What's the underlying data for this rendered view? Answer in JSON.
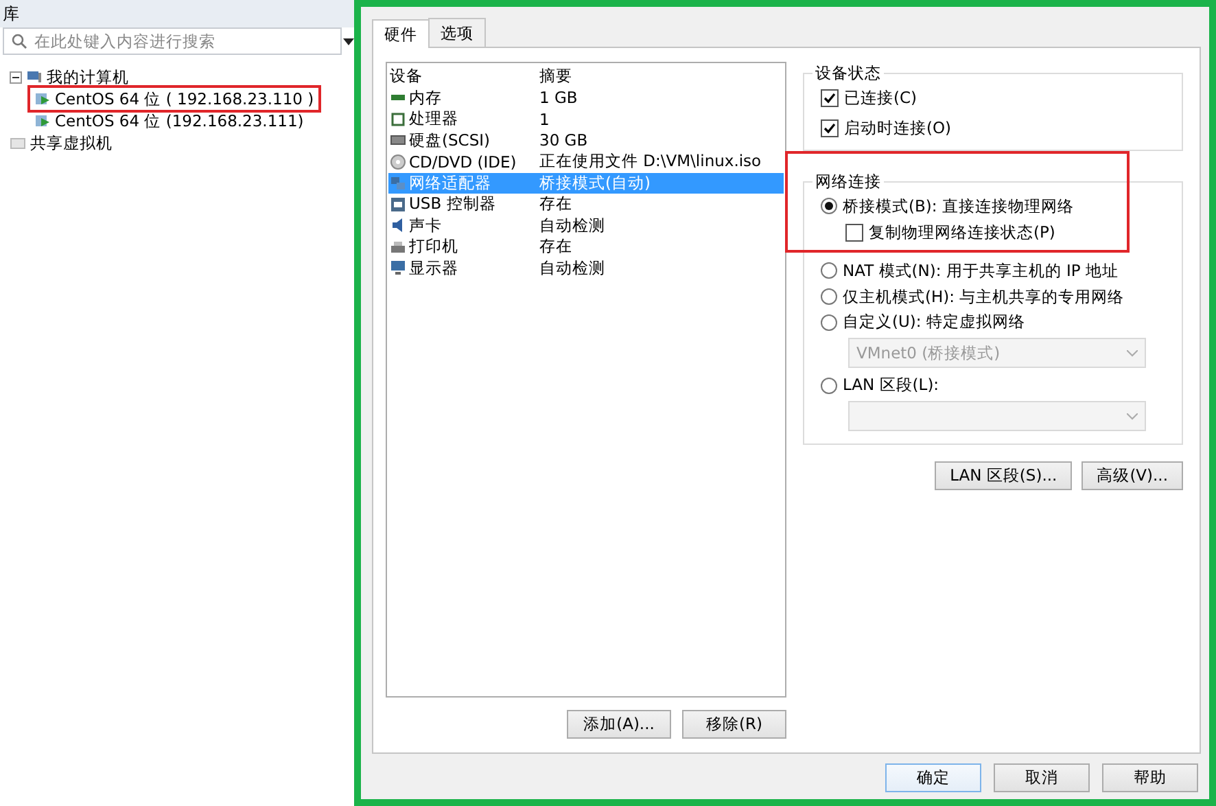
{
  "library": {
    "title": "库",
    "search": {
      "placeholder": "在此处键入内容进行搜索"
    },
    "tree": [
      {
        "label": "我的计算机",
        "kind": "computer",
        "expanded": true,
        "children": [
          {
            "label": "CentOS 64 位 ( 192.168.23.110 )",
            "kind": "vm",
            "highlighted": true
          },
          {
            "label": "CentOS 64 位 (192.168.23.111)",
            "kind": "vm",
            "highlighted": false
          }
        ]
      },
      {
        "label": "共享虚拟机",
        "kind": "shared"
      }
    ]
  },
  "dialog": {
    "tabs": [
      {
        "label": "硬件",
        "selected": true
      },
      {
        "label": "选项",
        "selected": false
      }
    ],
    "devices": {
      "columns": [
        "设备",
        "摘要"
      ],
      "rows": [
        {
          "kind": "memory",
          "device": "内存",
          "summary": "1 GB",
          "selected": false
        },
        {
          "kind": "cpu",
          "device": "处理器",
          "summary": "1",
          "selected": false
        },
        {
          "kind": "disk",
          "device": "硬盘(SCSI)",
          "summary": "30 GB",
          "selected": false
        },
        {
          "kind": "cdrom",
          "device": "CD/DVD (IDE)",
          "summary": "正在使用文件 D:\\VM\\linux.iso",
          "selected": false
        },
        {
          "kind": "network",
          "device": "网络适配器",
          "summary": "桥接模式(自动)",
          "selected": true
        },
        {
          "kind": "usb",
          "device": "USB 控制器",
          "summary": "存在",
          "selected": false
        },
        {
          "kind": "sound",
          "device": "声卡",
          "summary": "自动检测",
          "selected": false
        },
        {
          "kind": "printer",
          "device": "打印机",
          "summary": "存在",
          "selected": false
        },
        {
          "kind": "display",
          "device": "显示器",
          "summary": "自动检测",
          "selected": false
        }
      ],
      "buttons": [
        "添加(A)...",
        "移除(R)"
      ]
    },
    "device_status": {
      "title": "设备状态",
      "options": [
        {
          "label": "已连接(C)",
          "checked": true
        },
        {
          "label": "启动时连接(O)",
          "checked": true
        }
      ]
    },
    "network": {
      "title": "网络连接",
      "highlighted": true,
      "items": [
        {
          "kind": "radio",
          "label": "桥接模式(B): 直接连接物理网络",
          "selected": true
        },
        {
          "kind": "checkbox",
          "label": "复制物理网络连接状态(P)",
          "checked": false
        },
        {
          "kind": "radio",
          "label": "NAT 模式(N): 用于共享主机的 IP 地址",
          "selected": false
        },
        {
          "kind": "radio",
          "label": "仅主机模式(H): 与主机共享的专用网络",
          "selected": false
        },
        {
          "kind": "radio",
          "label": "自定义(U): 特定虚拟网络",
          "selected": false
        },
        {
          "kind": "select",
          "value": "VMnet0 (桥接模式)",
          "disabled": true
        },
        {
          "kind": "radio",
          "label": "LAN 区段(L):",
          "selected": false
        },
        {
          "kind": "select",
          "disabled": true
        }
      ],
      "buttons": [
        "LAN 区段(S)...",
        "高级(V)..."
      ]
    },
    "footer_buttons": [
      {
        "label": "确定",
        "default": true
      },
      {
        "label": "取消",
        "default": false
      },
      {
        "label": "帮助",
        "default": false
      }
    ]
  }
}
